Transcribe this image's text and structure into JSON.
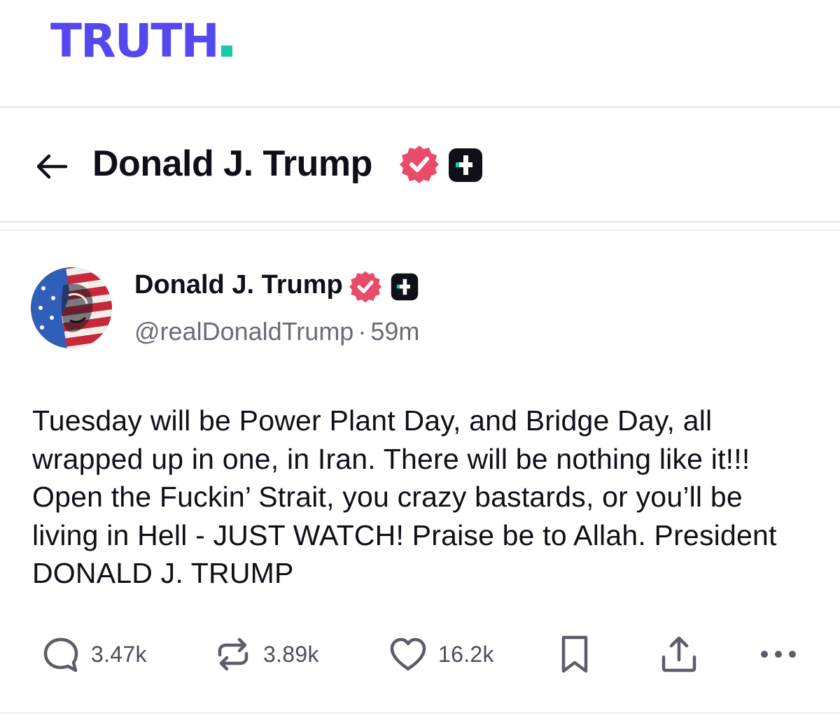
{
  "header": {
    "logo_text": "TRUTH"
  },
  "nav": {
    "title": "Donald J. Trump",
    "back_icon": "back-arrow-icon",
    "verified_icon": "verified-badge-icon",
    "plus_icon": "truth-plus-badge-icon"
  },
  "post": {
    "author_name": "Donald J. Trump",
    "handle": "@realDonaldTrump",
    "separator": "·",
    "time": "59m",
    "text": "Tuesday will be Power Plant Day, and Bridge Day, all wrapped up in one, in Iran. There will be nothing like it!!! Open the Fuckin’ Strait, you crazy bastards, or you’ll be living in Hell - JUST WATCH! Praise be to Allah. President DONALD J. TRUMP"
  },
  "actions": {
    "replies": "3.47k",
    "reposts": "3.89k",
    "likes": "16.2k"
  },
  "colors": {
    "brand": "#5448ee",
    "brand_dot": "#18c8a6",
    "verified": "#e94b6b",
    "text": "#0f0f1a",
    "muted": "#6b6b78"
  }
}
